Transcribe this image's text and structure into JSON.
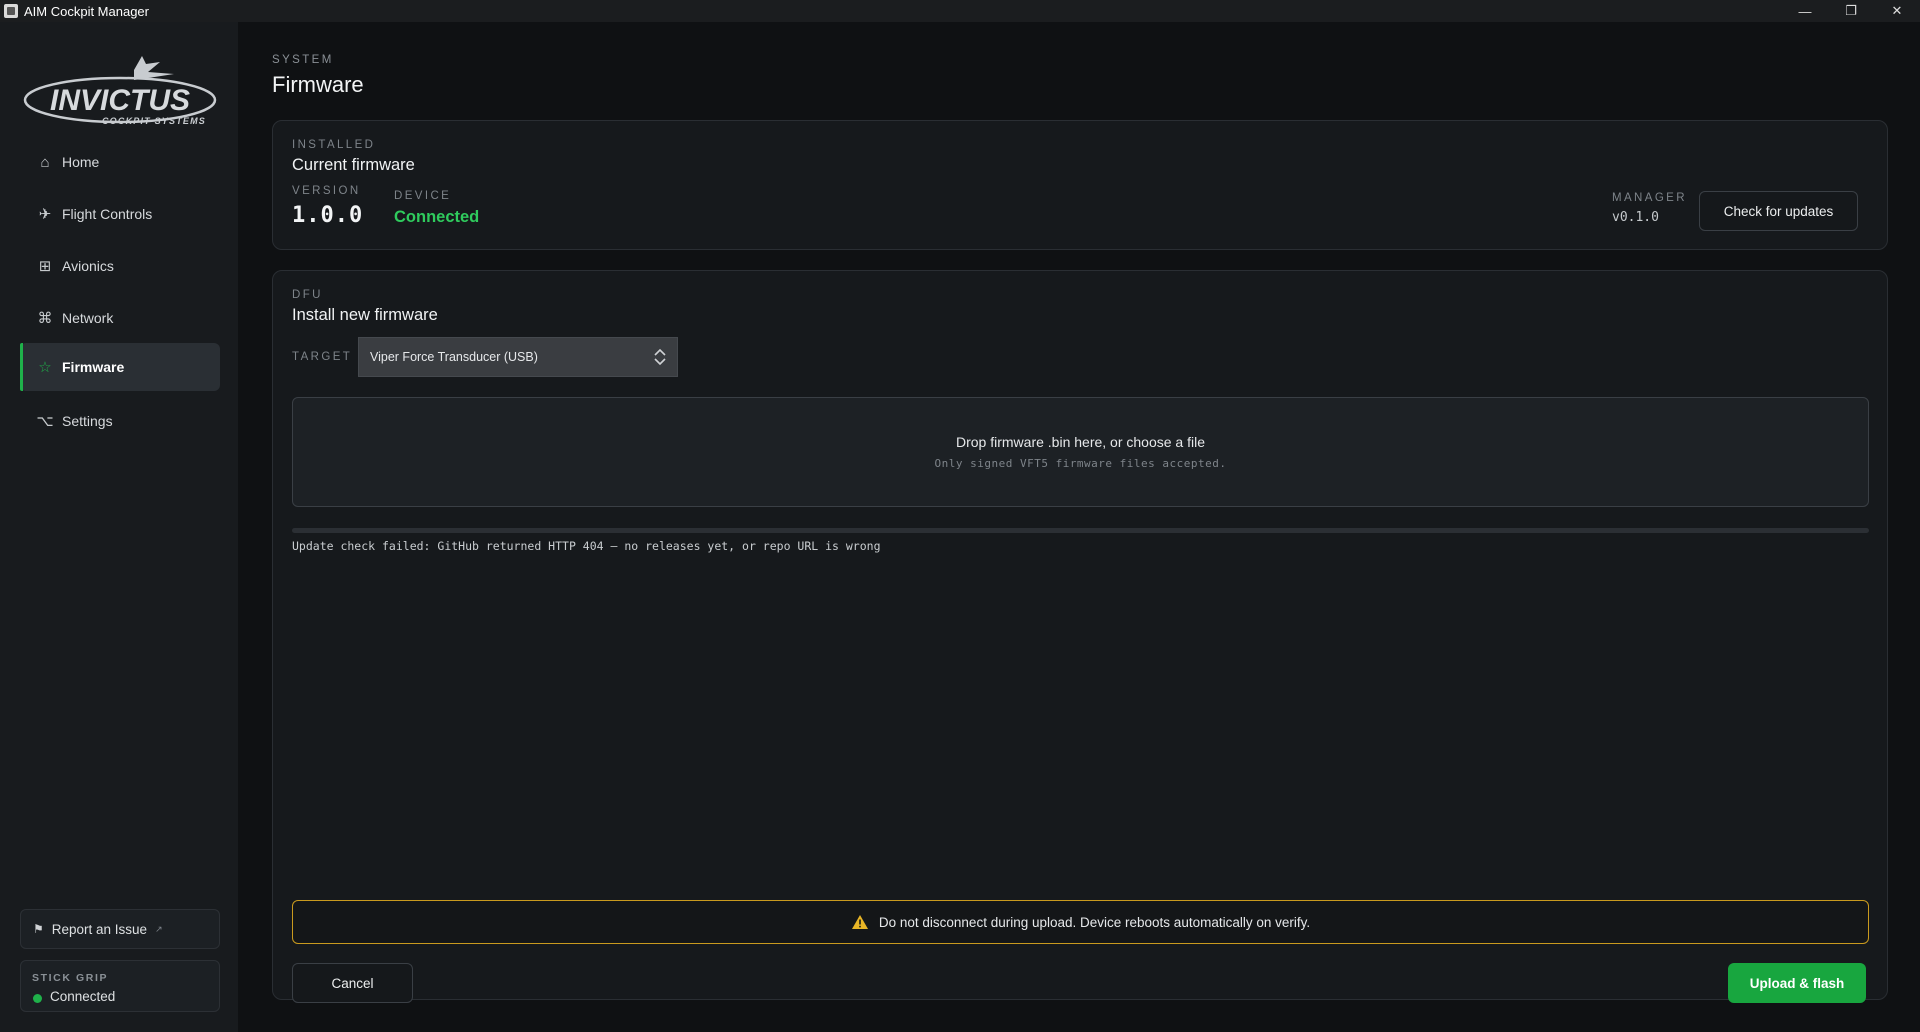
{
  "window": {
    "title": "AIM Cockpit Manager",
    "controls": {
      "minimize": "—",
      "restore": "❐",
      "close": "✕"
    }
  },
  "brand": {
    "name": "INVICTUS",
    "tagline": "COCKPIT SYSTEMS"
  },
  "sidebar": {
    "items": [
      {
        "label": "Home",
        "icon": "home-icon",
        "glyph": "⌂",
        "active": false
      },
      {
        "label": "Flight Controls",
        "icon": "airplane-icon",
        "glyph": "✈",
        "active": false
      },
      {
        "label": "Avionics",
        "icon": "grid-icon",
        "glyph": "⊞",
        "active": false
      },
      {
        "label": "Network",
        "icon": "command-icon",
        "glyph": "⌘",
        "active": false
      },
      {
        "label": "Firmware",
        "icon": "star-icon",
        "glyph": "☆",
        "active": true
      },
      {
        "label": "Settings",
        "icon": "option-icon",
        "glyph": "⌥",
        "active": false
      }
    ],
    "report": {
      "label": "Report an Issue",
      "icon": "flag-icon",
      "glyph": "⚑",
      "external_glyph": "↗"
    },
    "device_status": {
      "caption": "STICK GRIP",
      "value": "Connected",
      "color": "#1fb14a"
    }
  },
  "page": {
    "section": "SYSTEM",
    "title": "Firmware"
  },
  "installed": {
    "kicker": "INSTALLED",
    "title": "Current firmware",
    "version_label": "VERSION",
    "version": "1.0.0",
    "device_label": "DEVICE",
    "device": "Connected",
    "manager_label": "MANAGER",
    "manager_version": "v0.1.0",
    "check_button": "Check for updates"
  },
  "dfu": {
    "kicker": "DFU",
    "title": "Install new firmware",
    "target_label": "TARGET",
    "target_value": "Viper Force Transducer (USB)",
    "dropzone_text": "Drop firmware .bin here, or choose a file",
    "dropzone_hint": "Only signed VFT5 firmware files accepted.",
    "progress": 0,
    "status": "Update check failed: GitHub returned HTTP 404 — no releases yet, or repo URL is wrong",
    "warning": "Do not disconnect during upload. Device reboots automatically on verify.",
    "cancel_button": "Cancel",
    "upload_button": "Upload & flash"
  },
  "colors": {
    "accent": "#1fb14a",
    "warning": "#c99a1e",
    "connected": "#2fcb5d"
  }
}
